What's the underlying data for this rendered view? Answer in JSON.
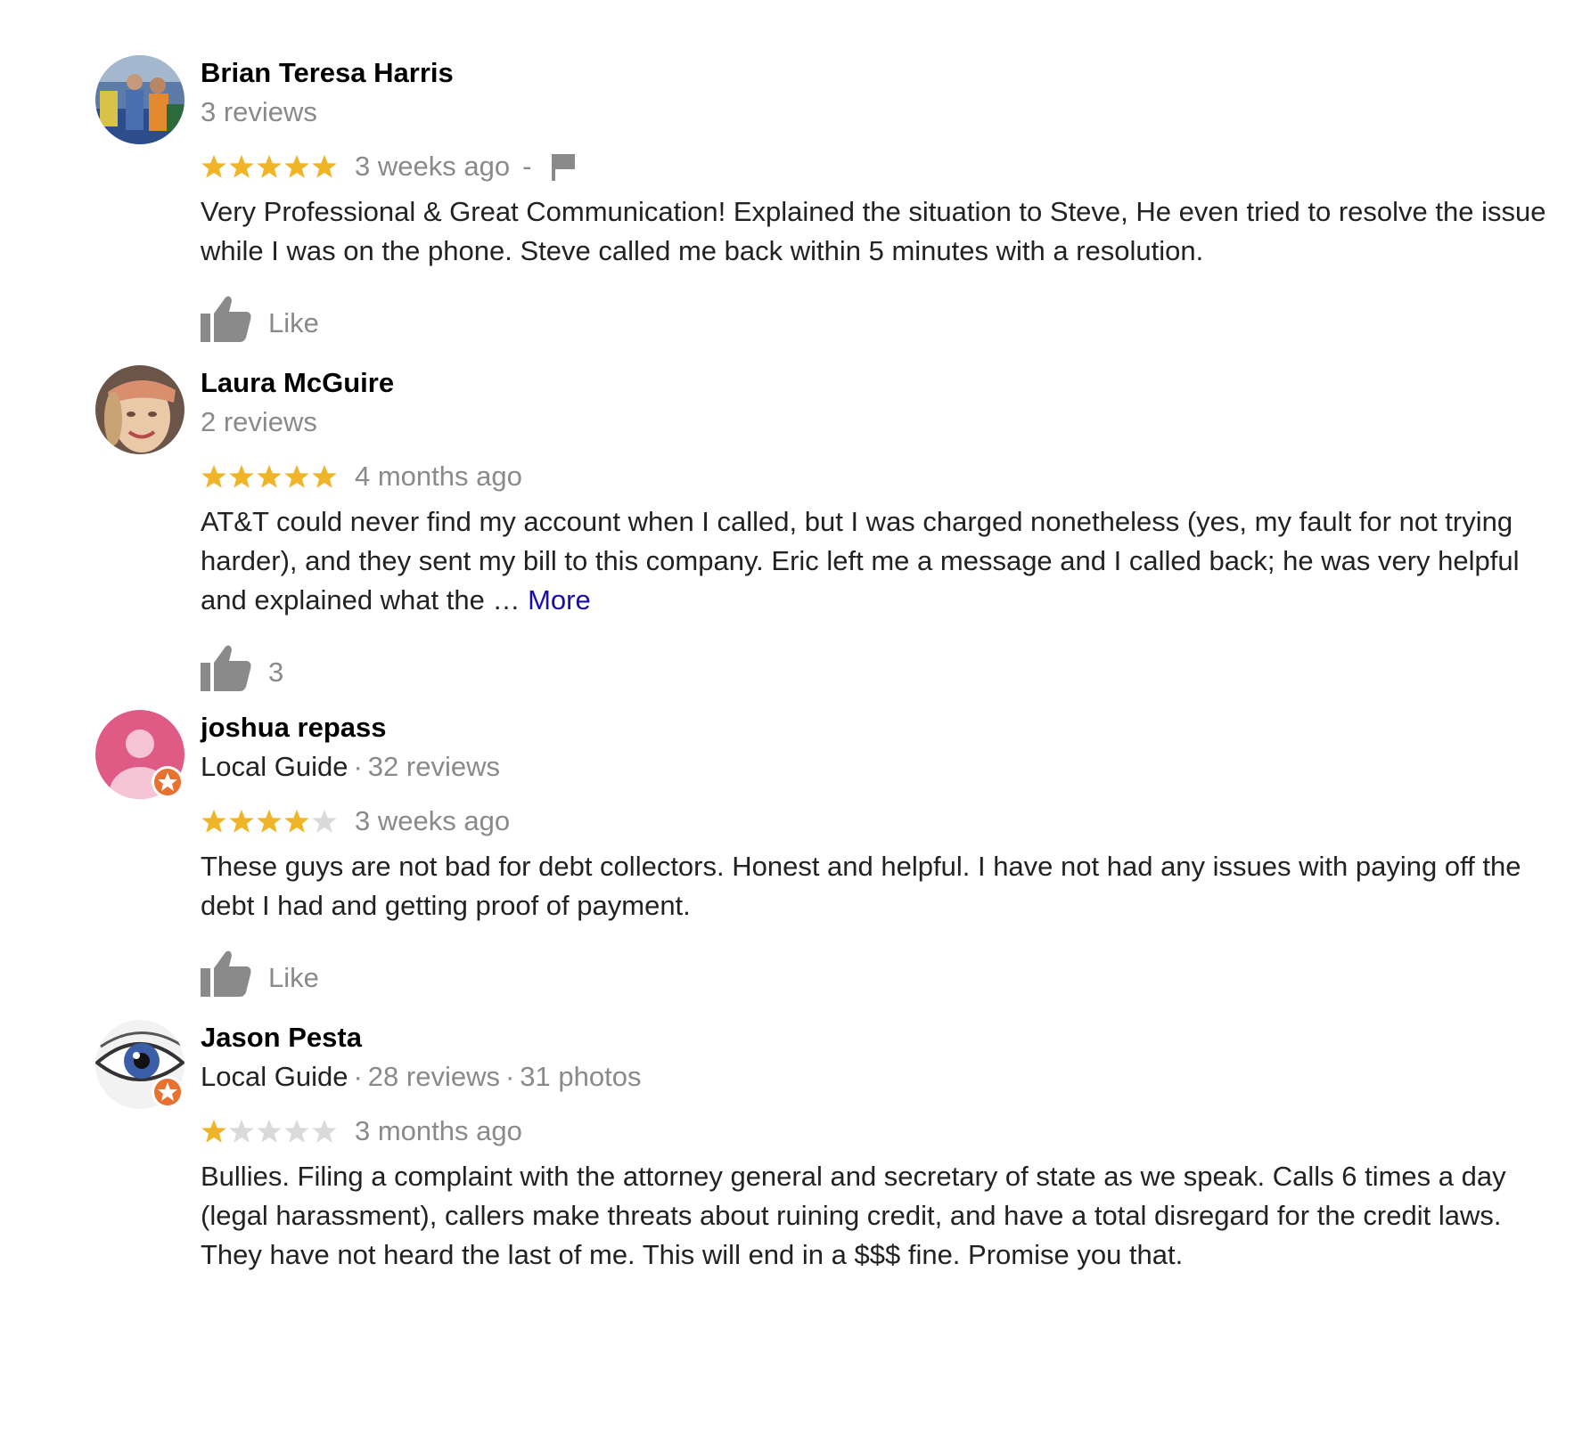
{
  "reviews": [
    {
      "author": "Brian Teresa Harris",
      "avatar": "photo-avatar-two-people",
      "local_guide": "",
      "reviews_count": "3 reviews",
      "photos_count": "",
      "rating": 5,
      "time": "3 weeks ago",
      "separator": "-",
      "flag_icon": "flag-icon",
      "text": "Very Professional & Great Communication! Explained the situation to Steve, He even tried to resolve the issue while I was on the phone. Steve called me back within 5 minutes with a resolution.",
      "more": "",
      "like_label": "Like"
    },
    {
      "author": "Laura McGuire",
      "avatar": "photo-avatar-woman",
      "local_guide": "",
      "reviews_count": "2 reviews",
      "photos_count": "",
      "rating": 5,
      "time": "4 months ago",
      "separator": "",
      "flag_icon": "",
      "text": "AT&T could never find my account when I called, but I was charged nonetheless (yes, my fault for not trying harder), and they sent my bill to this company. Eric left me a message and I called back; he was very helpful and explained what the … ",
      "more": "More",
      "like_label": "3"
    },
    {
      "author": "joshua repass",
      "avatar": "default-person-avatar",
      "local_guide": "Local Guide",
      "reviews_count": "32 reviews",
      "photos_count": "",
      "rating": 4,
      "time": "3 weeks ago",
      "separator": "",
      "flag_icon": "",
      "text": "These guys are not bad for debt collectors. Honest and helpful. I have not had any issues with paying off the debt I had and getting proof of payment.",
      "more": "",
      "like_label": "Like"
    },
    {
      "author": "Jason Pesta",
      "avatar": "photo-avatar-eye",
      "local_guide": "Local Guide",
      "reviews_count": "28 reviews",
      "photos_count": "31 photos",
      "rating": 1,
      "time": "3 months ago",
      "separator": "",
      "flag_icon": "",
      "text": "Bullies. Filing a complaint with the attorney general and secretary of state as we speak. Calls 6 times a day (legal harassment), callers make threats about ruining credit, and have a total disregard for the credit laws. They have not heard the last of me. This will end in a $$$ fine. Promise you that.",
      "more": "",
      "like_label": ""
    }
  ],
  "colors": {
    "star_filled": "#f0b429",
    "star_empty": "#dadada",
    "secondary_text": "#8a8a8a",
    "body_text": "#222222",
    "link": "#1a0dab",
    "guide_badge": "#e8712f",
    "default_avatar_bg": "#e05a86",
    "thumb_icon": "#8a8a8a"
  }
}
